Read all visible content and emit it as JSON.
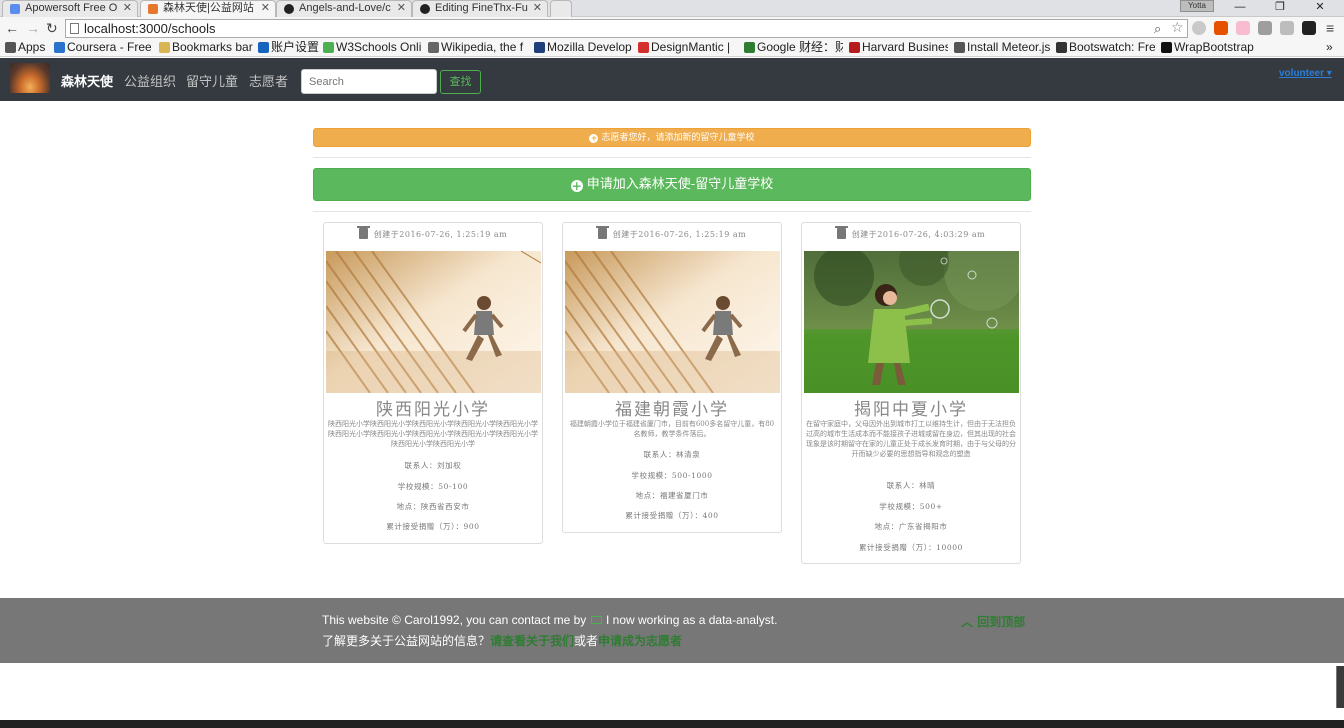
{
  "browser": {
    "tabs": [
      {
        "title": "Apowersoft Free O",
        "icon_color": "#5b8def"
      },
      {
        "title": "森林天使|公益网站",
        "icon_color": "#e8772e"
      },
      {
        "title": "Angels-and-Love/c",
        "icon_color": "#222222"
      },
      {
        "title": "Editing FineThx-Fu",
        "icon_color": "#222222"
      }
    ],
    "profile_label": "Yotta",
    "url": "localhost:3000/schools",
    "bookmarks": [
      {
        "label": "Apps",
        "icon_color": "#555555"
      },
      {
        "label": "Coursera - Free",
        "icon_color": "#2a73cc"
      },
      {
        "label": "Bookmarks bar",
        "icon_color": "#d8b452"
      },
      {
        "label": "账户设置",
        "icon_color": "#1565c0"
      },
      {
        "label": "W3Schools Onli",
        "icon_color": "#4caf50"
      },
      {
        "label": "Wikipedia, the f",
        "icon_color": "#666666"
      },
      {
        "label": "Mozilla Develop",
        "icon_color": "#1e3f7a"
      },
      {
        "label": "DesignMantic | ",
        "icon_color": "#d32f2f"
      },
      {
        "label": "Google 财经：财",
        "icon_color": "#2e7d32"
      },
      {
        "label": "Harvard Busines",
        "icon_color": "#b71c1c"
      },
      {
        "label": "Install Meteor.js",
        "icon_color": "#555555"
      },
      {
        "label": "Bootswatch: Fre",
        "icon_color": "#333333"
      },
      {
        "label": "WrapBootstrap",
        "icon_color": "#111111"
      }
    ]
  },
  "site": {
    "brand": "森林天使",
    "nav_links": [
      "公益组织",
      "留守儿童",
      "志愿者"
    ],
    "search_placeholder": "Search",
    "search_button": "查找",
    "user_menu": "volunteer ▾"
  },
  "alert_text": "志愿者您好，请添加新的留守儿童学校",
  "apply_button": "申请加入森林天使-留守儿童学校",
  "cards": [
    {
      "created": "创建于2016-07-26, 1:25:19 am",
      "image": "child-running-on-stairs",
      "name": "陕西阳光小学",
      "description": "陕西阳光小学陕西阳光小学陕西阳光小学陕西阳光小学陕西阳光小学陕西阳光小学陕西阳光小学陕西阳光小学陕西阳光小学陕西阳光小学陕西阳光小学陕西阳光小学",
      "contact": "联系人：刘加权",
      "scale": "学校规模：50-100",
      "location": "地点：陕西省西安市",
      "donation": "累计接受捐赠（万）：900"
    },
    {
      "created": "创建于2016-07-26, 1:25:19 am",
      "image": "child-running-on-stairs",
      "name": "福建朝霞小学",
      "description": "福建朝霞小学位于福建省厦门市，目前有600多名留守儿童，有80名教师，教学条件落后。",
      "contact": "联系人：林清泉",
      "scale": "学校规模：500-1000",
      "location": "地点：福建省厦门市",
      "donation": "累计接受捐赠（万）：400"
    },
    {
      "created": "创建于2016-07-26, 4:03:29 am",
      "image": "girl-with-bubbles",
      "name": "揭阳中夏小学",
      "description": "在留守家庭中，父母因外出到城市打工以维持生计，但由于无法担负过高的城市生活成本而不能接孩子进城或留在身边，但其出现的社会现象是该时期留守在家的儿童正处于成长发育时期，由于与父母的分开而缺少必要的思想指导和观念的塑造",
      "contact": "联系人：林晴",
      "scale": "学校规模：500+",
      "location": "地点：广东省揭阳市",
      "donation": "累计接受捐赠（万）：10000"
    }
  ],
  "footer": {
    "line1_prefix": "This website © Carol1992, you can contact me by",
    "line1_suffix": "I now working as a data-analyst.",
    "line2_prefix": "了解更多关于公益网站的信息？",
    "about_link": "请查看关于我们",
    "or_text": "或者",
    "volunteer_link": "申请成为志愿者",
    "back_to_top": "回到顶部"
  },
  "colors": {
    "navbar": "#343a40",
    "alert": "#f0ad4e",
    "success": "#5cb85c",
    "footer": "#777777",
    "link_green": "#2e7d32"
  }
}
